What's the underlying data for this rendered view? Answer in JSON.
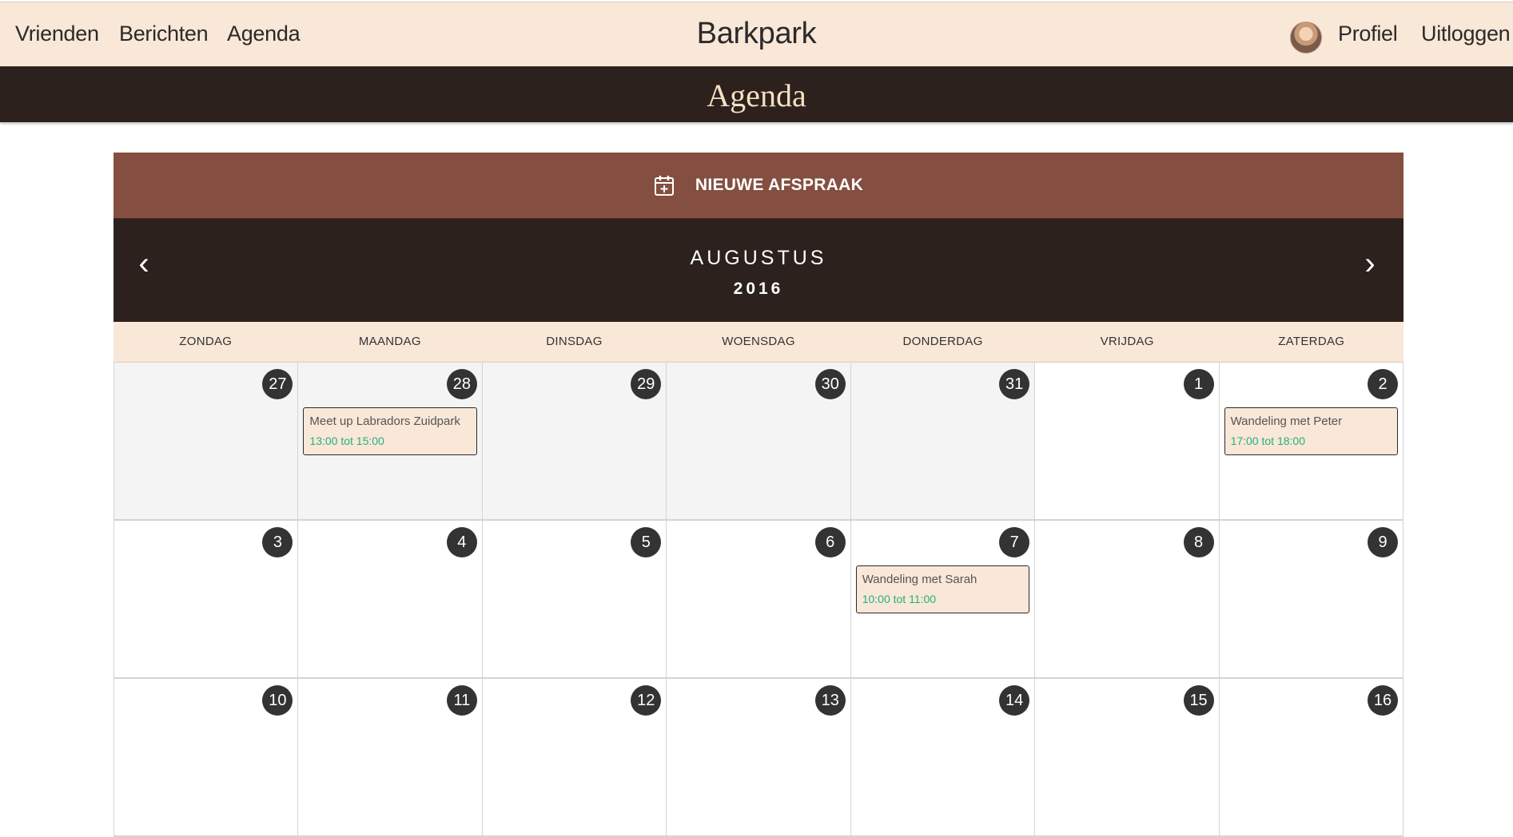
{
  "nav": {
    "left_links": [
      "Vrienden",
      "Berichten",
      "Agenda"
    ],
    "brand": "Barkpark",
    "profile_label": "Profiel",
    "logout_label": "Uitloggen"
  },
  "header": {
    "title": "Agenda"
  },
  "calendar": {
    "new_button_label": "NIEUWE AFSPRAAK",
    "new_button_icon": "calendar-plus-icon",
    "month": "AUGUSTUS",
    "year": "2016",
    "prev_arrow": "‹",
    "next_arrow": "›",
    "weekdays": [
      "ZONDAG",
      "MAANDAG",
      "DINSDAG",
      "WOENSDAG",
      "DONDERDAG",
      "VRIJDAG",
      "ZATERDAG"
    ],
    "weeks": [
      [
        {
          "day": "27",
          "muted": true
        },
        {
          "day": "28",
          "muted": true,
          "event": {
            "title": "Meet up Labradors Zuidpark",
            "time": "13:00 tot 15:00"
          }
        },
        {
          "day": "29",
          "muted": true
        },
        {
          "day": "30",
          "muted": true
        },
        {
          "day": "31",
          "muted": true
        },
        {
          "day": "1"
        },
        {
          "day": "2",
          "event": {
            "title": "Wandeling met Peter",
            "time": "17:00 tot 18:00"
          }
        }
      ],
      [
        {
          "day": "3"
        },
        {
          "day": "4"
        },
        {
          "day": "5"
        },
        {
          "day": "6"
        },
        {
          "day": "7",
          "event": {
            "title": "Wandeling met Sarah",
            "time": "10:00 tot 11:00"
          }
        },
        {
          "day": "8"
        },
        {
          "day": "9"
        }
      ],
      [
        {
          "day": "10"
        },
        {
          "day": "11"
        },
        {
          "day": "12"
        },
        {
          "day": "13"
        },
        {
          "day": "14"
        },
        {
          "day": "15"
        },
        {
          "day": "16"
        }
      ]
    ]
  },
  "colors": {
    "nav_bg": "#f9e7d7",
    "dark": "#2c211d",
    "accent_brown": "#844f40",
    "event_time": "#25b07e"
  }
}
